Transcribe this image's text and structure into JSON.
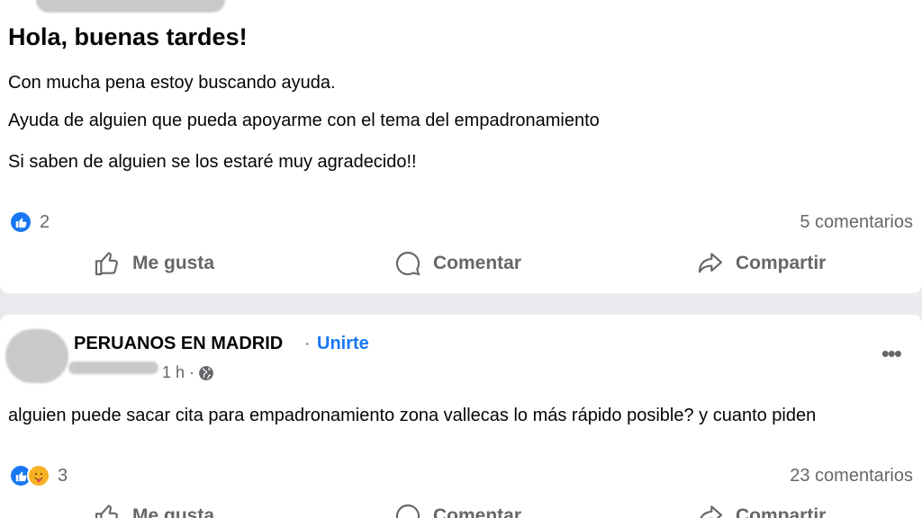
{
  "post1": {
    "headline": "Hola, buenas tardes!",
    "lines": [
      "Con mucha pena estoy buscando ayuda.",
      "Ayuda de alguien que pueda apoyarme con el tema del empadronamiento",
      "Si saben de alguien se los estaré muy agradecido!!"
    ],
    "reaction_count": "2",
    "comments": "5 comentarios"
  },
  "post2": {
    "group": "PERUANOS EN MADRID",
    "separator": "·",
    "join_label": "Unirte",
    "time": "1 h ·",
    "more": "•••",
    "text": "alguien puede sacar cita para empadronamiento zona vallecas lo más rápido posible? y cuanto piden",
    "reaction_count": "3",
    "comments": "23 comentarios"
  },
  "actions": {
    "like": "Me gusta",
    "comment": "Comentar",
    "share": "Compartir"
  },
  "colors": {
    "accent": "#1877f2",
    "muted": "#65676b",
    "background": "#e9ebee"
  }
}
